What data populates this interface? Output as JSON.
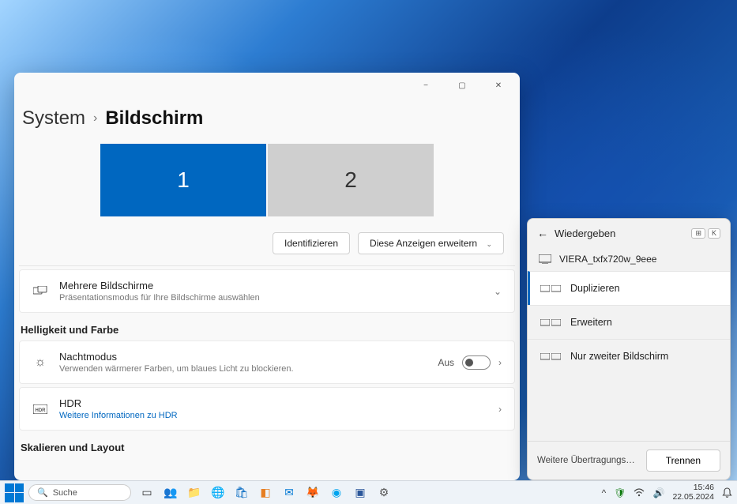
{
  "breadcrumb": {
    "parent": "System",
    "current": "Bildschirm"
  },
  "window": {
    "minimize": "−",
    "maximize": "▢",
    "close": "✕"
  },
  "displays": {
    "primary": "1",
    "secondary": "2"
  },
  "actions": {
    "identify": "Identifizieren",
    "extend": "Diese Anzeigen erweitern"
  },
  "rows": {
    "multi": {
      "title": "Mehrere Bildschirme",
      "subtitle": "Präsentationsmodus für Ihre Bildschirme auswählen"
    },
    "brightness_section": "Helligkeit und Farbe",
    "night": {
      "title": "Nachtmodus",
      "subtitle": "Verwenden wärmerer Farben, um blaues Licht zu blockieren.",
      "state": "Aus"
    },
    "hdr": {
      "title": "HDR",
      "subtitle": "Weitere Informationen zu HDR"
    },
    "scale_section": "Skalieren und Layout"
  },
  "flyout": {
    "title": "Wiedergeben",
    "keys": [
      "⊞",
      "K"
    ],
    "device": "VIERA_txfx720w_9eee",
    "items": [
      {
        "label": "Duplizieren",
        "active": true
      },
      {
        "label": "Erweitern",
        "active": false
      },
      {
        "label": "Nur zweiter Bildschirm",
        "active": false
      }
    ],
    "more": "Weitere Übertragungs…",
    "disconnect": "Trennen"
  },
  "taskbar": {
    "search_placeholder": "Suche",
    "apps": [
      {
        "name": "task-view",
        "color": "#333",
        "glyph": "▭"
      },
      {
        "name": "teams",
        "color": "#5059c9",
        "glyph": "👥"
      },
      {
        "name": "explorer",
        "color": "#ffcc4d",
        "glyph": "📁"
      },
      {
        "name": "edge",
        "color": "#0078d4",
        "glyph": "🌐"
      },
      {
        "name": "store",
        "color": "#0067c0",
        "glyph": "🛍"
      },
      {
        "name": "widgets",
        "color": "#e67e22",
        "glyph": "◧"
      },
      {
        "name": "outlook",
        "color": "#0078d4",
        "glyph": "✉"
      },
      {
        "name": "firefox",
        "color": "#ff7139",
        "glyph": "🦊"
      },
      {
        "name": "app1",
        "color": "#00a4ef",
        "glyph": "◉"
      },
      {
        "name": "app2",
        "color": "#2b579a",
        "glyph": "▣"
      },
      {
        "name": "settings",
        "color": "#555",
        "glyph": "⚙"
      }
    ],
    "tray": {
      "time": "15:46",
      "date": "22.05.2024"
    }
  }
}
